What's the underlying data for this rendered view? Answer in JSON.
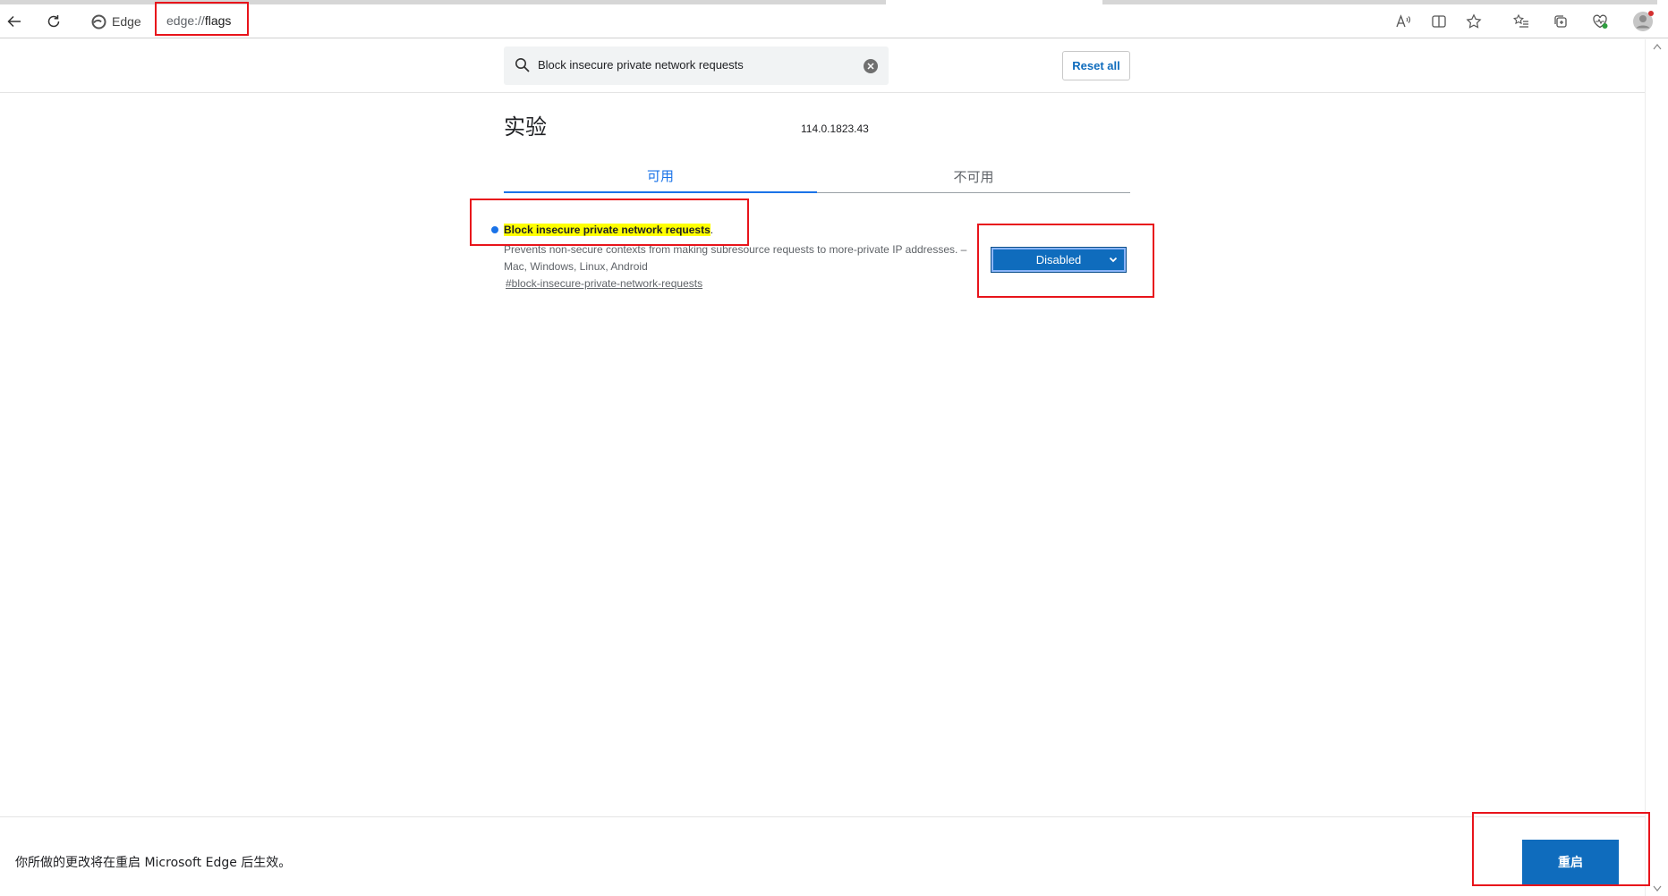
{
  "browser": {
    "site_chip": "Edge",
    "url_prefix": "edge://",
    "url_path": "flags"
  },
  "header": {
    "search_value": "Block insecure private network requests",
    "reset_label": "Reset all"
  },
  "main": {
    "title": "实验",
    "version": "114.0.1823.43",
    "tabs": [
      {
        "label": "可用",
        "active": true
      },
      {
        "label": "不可用",
        "active": false
      }
    ],
    "experiment": {
      "name": "Block insecure private network requests",
      "name_suffix": ".",
      "description": "Prevents non-secure contexts from making subresource requests to more-private IP addresses. – Mac, Windows, Linux, Android",
      "link": "#block-insecure-private-network-requests",
      "selected_option": "Disabled"
    }
  },
  "footer": {
    "message": "你所做的更改将在重启 Microsoft Edge 后生效。",
    "restart_label": "重启"
  },
  "colors": {
    "accent": "#0f6cbd",
    "tab_active": "#1a73e8",
    "highlight": "#ffff00",
    "annotation": "#e8141b"
  }
}
